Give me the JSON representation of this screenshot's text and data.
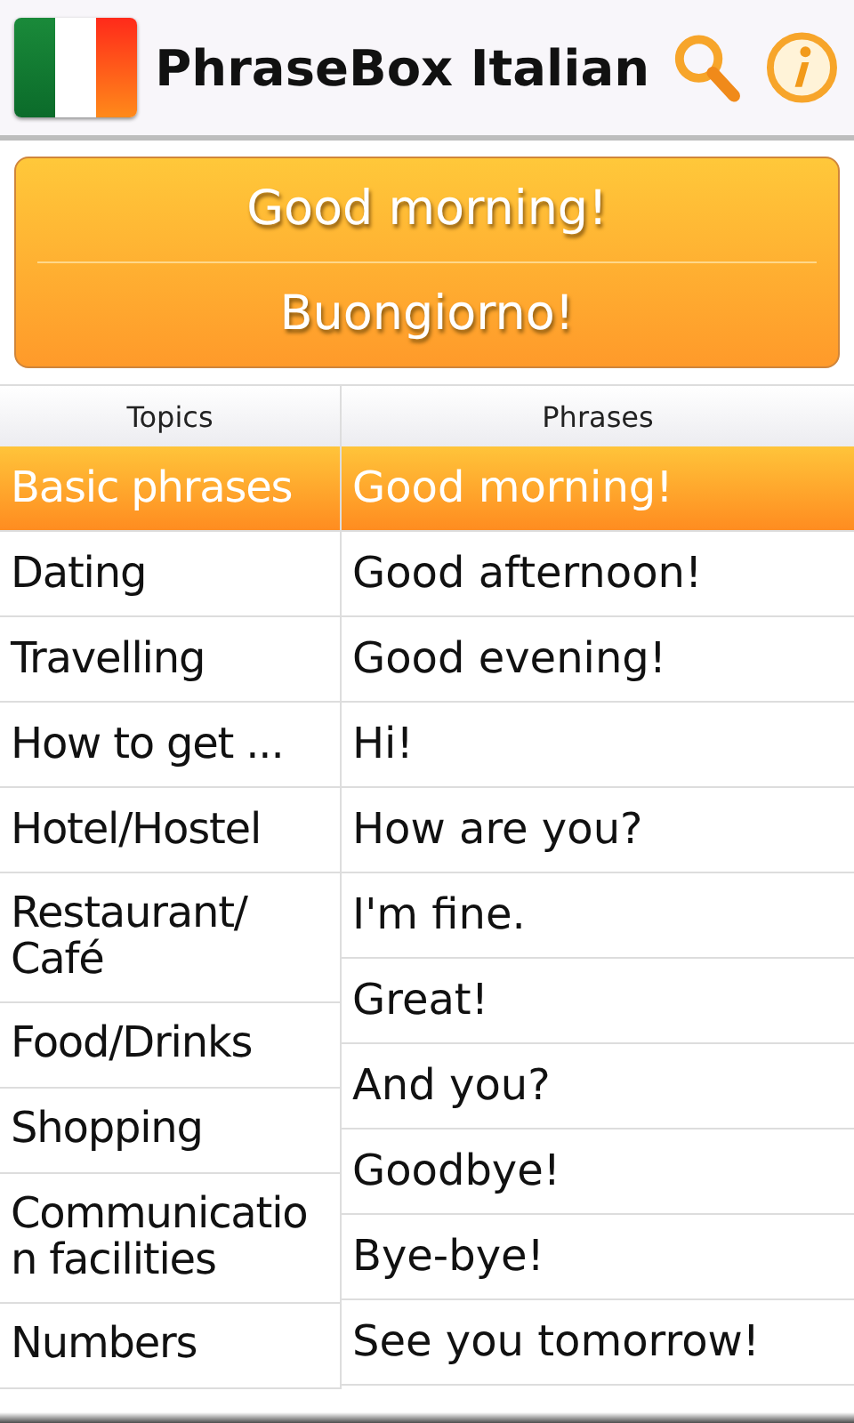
{
  "app_bar": {
    "title": "PhraseBox Italian"
  },
  "current_phrase": {
    "english": "Good morning!",
    "italian": "Buongiorno!"
  },
  "topics": {
    "heading": "Topics",
    "items": [
      {
        "label": "Basic phrases",
        "selected": true
      },
      {
        "label": "Dating",
        "selected": false
      },
      {
        "label": "Travelling",
        "selected": false
      },
      {
        "label": "How to get ...",
        "selected": false
      },
      {
        "label": "Hotel/Hostel",
        "selected": false
      },
      {
        "label": "Restaurant/ Café",
        "selected": false
      },
      {
        "label": "Food/Drinks",
        "selected": false
      },
      {
        "label": "Shopping",
        "selected": false
      },
      {
        "label": "Communication facilities",
        "selected": false
      },
      {
        "label": "Numbers",
        "selected": false
      }
    ]
  },
  "phrases": {
    "heading": "Phrases",
    "items": [
      {
        "label": "Good morning!",
        "selected": true
      },
      {
        "label": "Good afternoon!",
        "selected": false
      },
      {
        "label": "Good evening!",
        "selected": false
      },
      {
        "label": "Hi!",
        "selected": false
      },
      {
        "label": "How are you?",
        "selected": false
      },
      {
        "label": "I'm fine.",
        "selected": false
      },
      {
        "label": "Great!",
        "selected": false
      },
      {
        "label": "And you?",
        "selected": false
      },
      {
        "label": "Goodbye!",
        "selected": false
      },
      {
        "label": "Bye-bye!",
        "selected": false
      },
      {
        "label": "See you tomorrow!",
        "selected": false
      }
    ]
  }
}
